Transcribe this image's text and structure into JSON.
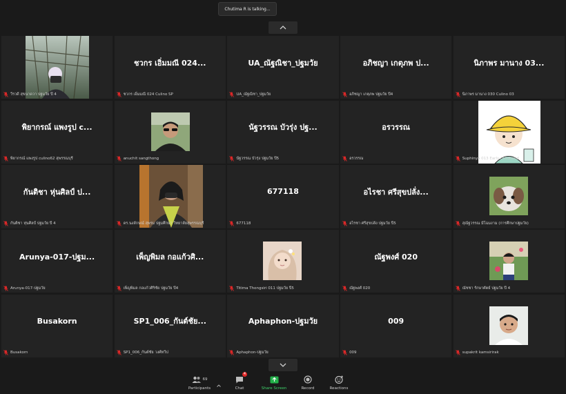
{
  "talking_indicator": "Chutima R is talking...",
  "colors": {
    "accent_green": "#23b04a",
    "mic_red": "#e02828",
    "tile_bg": "#232323"
  },
  "participants": [
    {
      "display": "",
      "label": "วีรวดี สุขนาดวา ปฐมวัย ปี 4",
      "video": "photo-man-camera"
    },
    {
      "display": "ชวกร เอิ่มมณี 024...",
      "label": "ชวกร เอิ่มมณี 024 Culino SP",
      "video": ""
    },
    {
      "display": "UA_ณัฐณิชา_ปฐมวัย",
      "label": "UA_ณัฐณิชา_ปฐมวัย",
      "video": ""
    },
    {
      "display": "อภิชญา เกตุภพ ป...",
      "label": "อภิชญา เกตุภพ ปฐมวัย ปี4",
      "video": ""
    },
    {
      "display": "นิภาพร มานาง 03...",
      "label": "นิภาพร มานาง 030 Culino 03",
      "video": ""
    },
    {
      "display": "พิยากรณ์ แพงรูป c...",
      "label": "พิยากรณ์ แพงรูป culino62 สุพรรณบุรี",
      "video": ""
    },
    {
      "display": "",
      "label": "anuchit sangthong",
      "video": "photo-man-sunglasses"
    },
    {
      "display": "นัฐวรรณ บัวรุ่ง ปฐ...",
      "label": "นัฐวรรณ บัวรุ่ง ปฐมวัย ปี5",
      "video": ""
    },
    {
      "display": "อรวรรณ",
      "label": "อรวรรณ",
      "video": ""
    },
    {
      "display": "",
      "label": "Suphinya 013 Early childhood",
      "video": "cartoon-hat"
    },
    {
      "display": "กันติชา หุ่นศิลป์ ป...",
      "label": "กันติชา หุ่นศิลป์ ปฐมวัย ปี 4",
      "video": ""
    },
    {
      "display": "",
      "label": "ดร.นงลักษณ์ สุพรม ปฐมศึกษา วิทยาลัยสุพรรณบุรี",
      "video": "photo-woman-mask"
    },
    {
      "display": "677118",
      "label": "677118",
      "video": ""
    },
    {
      "display": "อไรชา ศรีสุขปลั่ง...",
      "label": "อไรชา ศรีสุขปลั่ง ปฐมวัย ปี5",
      "video": ""
    },
    {
      "display": "",
      "label": "สุณัฐวรรณ มีโฉมงาม (การศึกษาปฐมวัย)",
      "video": "photo-dog"
    },
    {
      "display": "Arunya-017-ปฐม...",
      "label": "Arunya-017-ปฐมวัย",
      "video": ""
    },
    {
      "display": "เพ็ญพิมล กอแก้วศิ...",
      "label": "เพ็ญพิมล กอแก้วศิริชัย ปฐมวัย ปี4",
      "video": ""
    },
    {
      "display": "",
      "label": "Titima Thongsiri 011 ปฐมวัย ปี5",
      "video": "photo-girl"
    },
    {
      "display": "ณัฐพงศ์ 020",
      "label": "ณัฐพงศ์ 020",
      "video": ""
    },
    {
      "display": "",
      "label": "ณัชชา รักษาศัตย์ ปฐมวัย ปี 4",
      "video": "photo-girl-outdoor"
    },
    {
      "display": "Busakorn",
      "label": "Busakorn",
      "video": ""
    },
    {
      "display": "SP1_006_กันต์ชัย...",
      "label": "SP1_006_กันต์ชัย วงศ์ทวีป",
      "video": ""
    },
    {
      "display": "Aphaphon-ปฐมวัย",
      "label": "Aphaphon-ปฐมวัย",
      "video": ""
    },
    {
      "display": "009",
      "label": "009",
      "video": ""
    },
    {
      "display": "",
      "label": "supakrit kamsirirak",
      "video": "photo-boy"
    }
  ],
  "toolbar": {
    "participants_label": "Participants",
    "participants_count": "69",
    "chat_label": "Chat",
    "chat_badge": "4",
    "share_label": "Share Screen",
    "record_label": "Record",
    "reactions_label": "Reactions"
  }
}
